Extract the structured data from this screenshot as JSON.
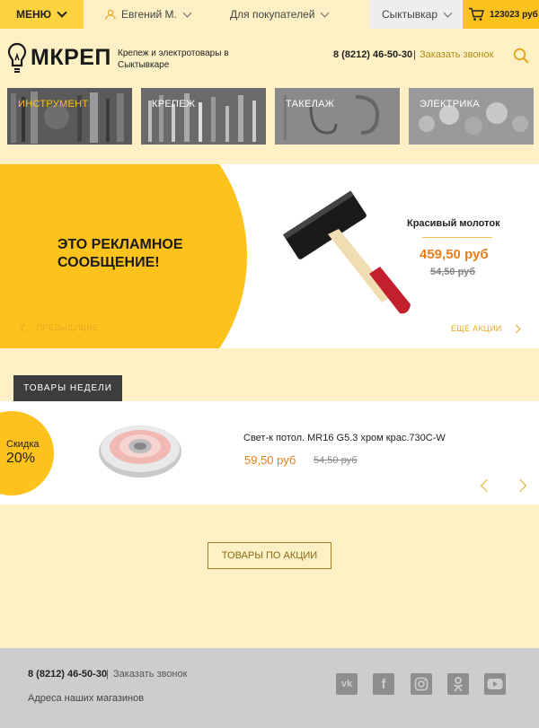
{
  "topbar": {
    "menu_label": "МЕНЮ",
    "user_name": "Евгений М.",
    "buyers_label": "Для покупателей",
    "city": "Сыктывкар",
    "cart_total": "123023 руб"
  },
  "header": {
    "logo_text": "МКРЕП",
    "tagline": "Крепеж и электротовары в Сыктывкаре",
    "phone": "8 (8212) 46-50-30",
    "separator": "|",
    "callback_label": "Заказать звонок"
  },
  "categories": [
    {
      "label": "ИНСТРУМЕНТ",
      "active": true
    },
    {
      "label": "КРЕПЕЖ",
      "active": false
    },
    {
      "label": "ТАКЕЛАЖ",
      "active": false
    },
    {
      "label": "ЭЛЕКТРИКА",
      "active": false
    }
  ],
  "banner": {
    "promo_text": "ЭТО РЕКЛАМНОЕ СООБЩЕНИЕ!",
    "prev_label": "ПРЕДЫДУЩИЕ",
    "product_title": "Красивый молоток",
    "price": "459,50 руб",
    "old_price": "54,50 руб",
    "more_label": "ЕЩЕ АКЦИИ"
  },
  "week": {
    "section_label": "ТОВАРЫ НЕДЕЛИ",
    "discount_label": "Скидка",
    "discount_value": "20%",
    "product_title": "Свет-к потол. MR16 G5.3 хром крас.730C-W",
    "price": "59,50 руб",
    "old_price": "54,50 руб"
  },
  "sale_button_label": "ТОВАРЫ ПО АКЦИИ",
  "footer": {
    "phone": "8 (8212) 46-50-30",
    "separator": "|",
    "callback_label": "Заказать звонок",
    "address_label": "Адреса наших магазинов",
    "social": [
      {
        "icon": "vk-icon",
        "glyph": "vk"
      },
      {
        "icon": "facebook-icon",
        "glyph": "f"
      },
      {
        "icon": "instagram-icon",
        "glyph": ""
      },
      {
        "icon": "odnoklassniki-icon",
        "glyph": ""
      },
      {
        "icon": "youtube-icon",
        "glyph": ""
      }
    ]
  },
  "colors": {
    "accent": "#fdc21b",
    "background": "#fdf0c4",
    "price": "#e87e1c",
    "footer": "#cdcdcd"
  }
}
